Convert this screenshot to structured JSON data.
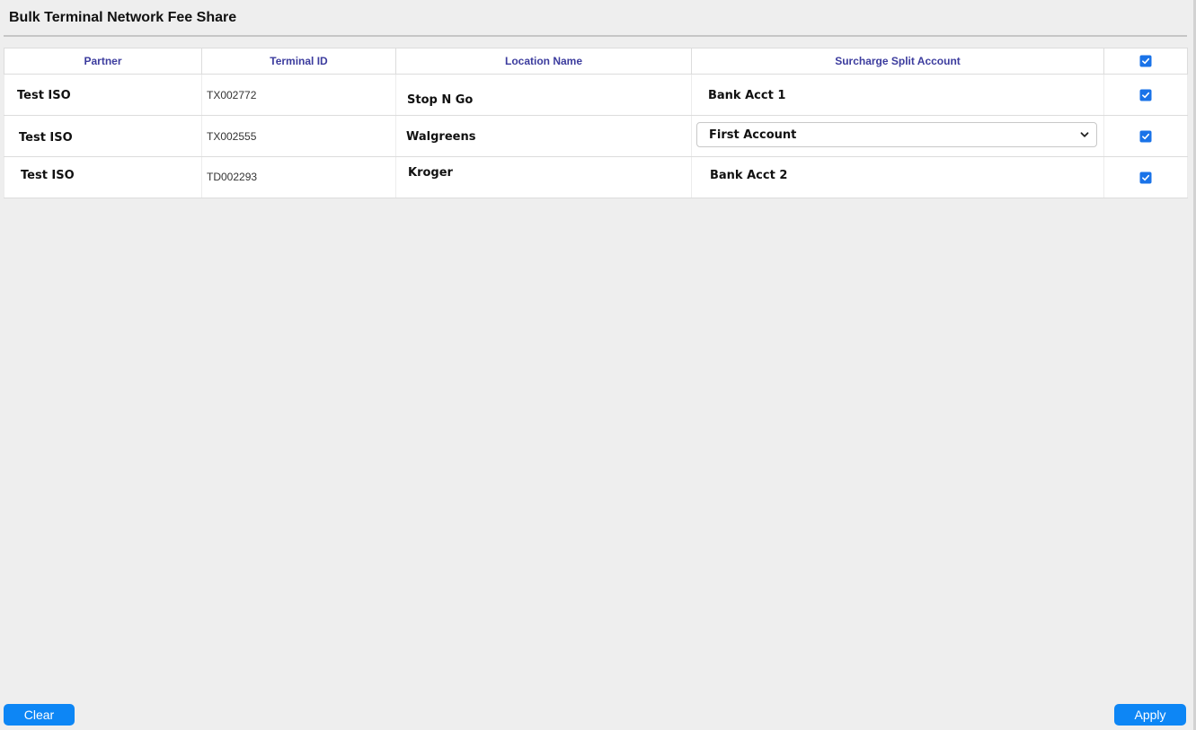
{
  "page": {
    "title": "Bulk Terminal Network Fee Share"
  },
  "table": {
    "columns": [
      "Partner",
      "Terminal ID",
      "Location Name",
      "Surcharge Split Account"
    ],
    "select_all_checked": true,
    "rows": [
      {
        "partner": "Test ISO",
        "terminal_id": "TX002772",
        "location": "Stop N Go",
        "account": "Bank Acct 1",
        "account_is_dropdown": false,
        "checked": true
      },
      {
        "partner": "Test ISO",
        "terminal_id": "TX002555",
        "location": "Walgreens",
        "account": "First Account",
        "account_is_dropdown": true,
        "checked": true
      },
      {
        "partner": "Test ISO",
        "terminal_id": "TD002293",
        "location": "Kroger",
        "account": "Bank Acct 2",
        "account_is_dropdown": false,
        "checked": true
      }
    ]
  },
  "buttons": {
    "clear": "Clear",
    "apply": "Apply"
  },
  "icons": {
    "checkbox": "checkbox-checked-icon",
    "dropdown": "chevron-down-icon"
  },
  "colors": {
    "accent": "#0d86f5",
    "checkbox": "#1a73e8",
    "header_text": "#3c3c9e",
    "background": "#eeeeee"
  }
}
